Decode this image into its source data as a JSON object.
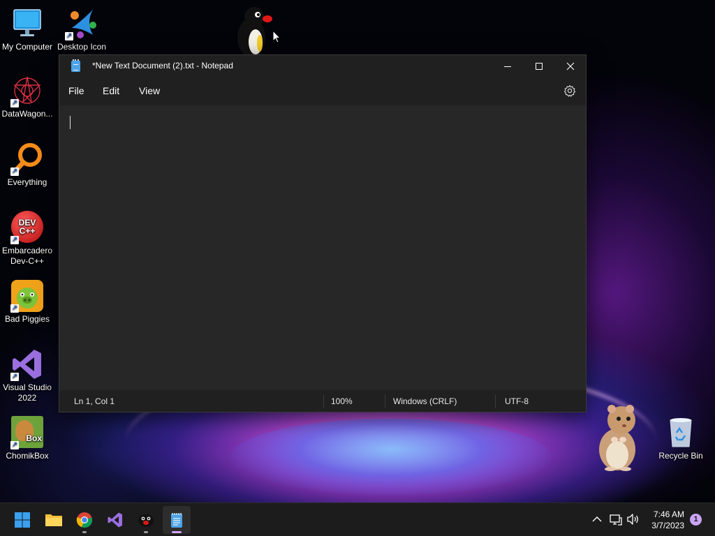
{
  "desktop": {
    "icons": [
      {
        "label": "My Computer"
      },
      {
        "label": "Desktop Icon"
      },
      {
        "label": "DataWagon..."
      },
      {
        "label": "Everything"
      },
      {
        "label": "Embarcadero Dev-C++"
      },
      {
        "label": "Bad Piggies"
      },
      {
        "label": "Visual Studio 2022"
      },
      {
        "label": "ChomikBox"
      },
      {
        "label": "Recycle Bin"
      }
    ],
    "devcpp_logo_text": "DEV C++",
    "chomikbox_logo_text": "Box"
  },
  "notepad": {
    "title": "*New Text Document (2).txt - Notepad",
    "menu": {
      "file": "File",
      "edit": "Edit",
      "view": "View"
    },
    "content": "",
    "status": {
      "position": "Ln 1, Col 1",
      "zoom": "100%",
      "line_ending": "Windows (CRLF)",
      "encoding": "UTF-8"
    }
  },
  "taskbar": {
    "apps": [
      "start-icon",
      "file-explorer-icon",
      "chrome-icon",
      "visual-studio-icon",
      "pingu-icon",
      "notepad-icon"
    ],
    "clock": {
      "time": "7:46 AM",
      "date": "3/7/2023"
    },
    "notification_count": "1"
  },
  "colors": {
    "accent": "#d4a5ff",
    "window_bg": "#202020",
    "editor_bg": "#272727"
  }
}
